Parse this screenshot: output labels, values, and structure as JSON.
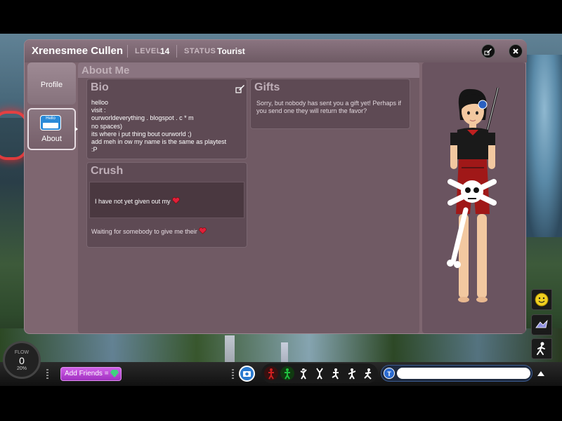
{
  "profile": {
    "name": "Xrenesmee Cullen",
    "level_key": "LEVEL",
    "level": "14",
    "status_key": "STATUS",
    "status": "Tourist"
  },
  "nav": {
    "profile_label": "Profile",
    "about_label": "About",
    "hello_badge": "Hello"
  },
  "about": {
    "header": "About Me",
    "bio_title": "Bio",
    "bio_text": "helloo\nvisit :\nourworldeverything . blogspot . c * m\nno spaces)\nits where i put thing bout ourworld ;)\nadd meh in ow my name is the same as playtest\n:P",
    "crush_title": "Crush",
    "crush_text": "I have not yet given out my",
    "crush_waiting": "Waiting for somebody to give me their",
    "gifts_title": "Gifts",
    "gifts_text": "Sorry, but nobody has sent you a gift yet! Perhaps if you send one they will return the favor?"
  },
  "bottom": {
    "flow_label": "FLOW",
    "flow_value": "0",
    "flow_percent": "20%",
    "add_friends": "Add Friends =",
    "chat_icon_letter": "T",
    "chat_placeholder": ""
  },
  "icons": {
    "edit": "edit-icon",
    "close": "close-icon",
    "smiley": "smiley-icon",
    "dance": "dance-icon",
    "walk": "walk-icon",
    "camera": "camera-icon",
    "heart": "heart-icon"
  },
  "colors": {
    "window_bg": "#7e6670",
    "card_bg": "#5e4a54",
    "heart": "#e0203a",
    "add_friends": "#c050e0",
    "emote_red": "#d02020",
    "emote_green": "#20c040"
  }
}
